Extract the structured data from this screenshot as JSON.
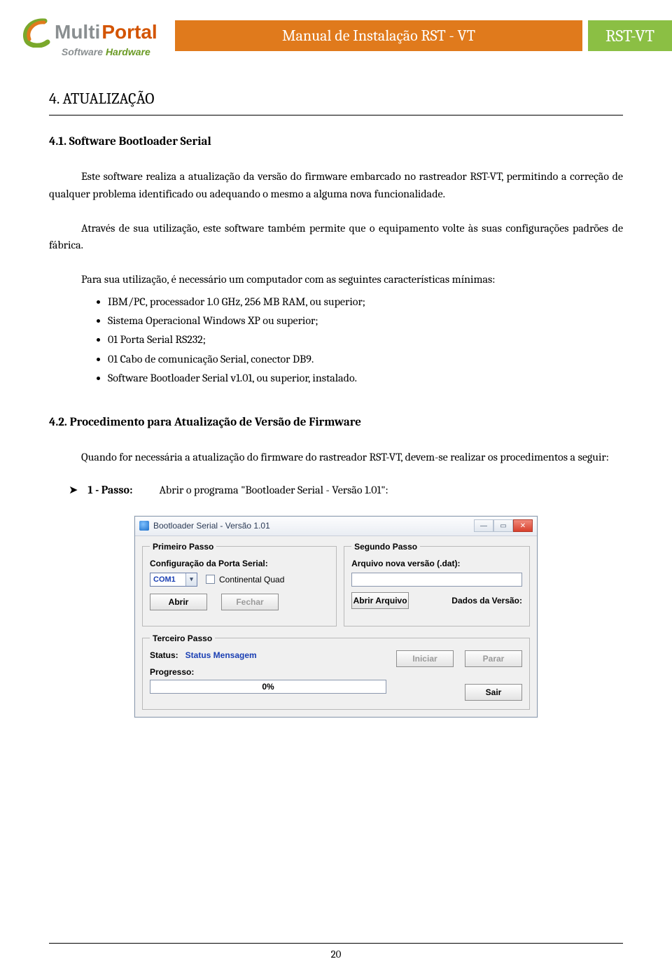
{
  "header": {
    "logo_main_1": "Multi",
    "logo_main_2": "Portal",
    "logo_sub_1": "Software",
    "logo_sub_2": "Hardware",
    "title": "Manual de Instalação RST - VT",
    "badge": "RST-VT"
  },
  "section": {
    "heading": "4. ATUALIZAÇÃO",
    "sub1": "4.1. Software Bootloader Serial",
    "p1": "Este software realiza a atualização da versão do firmware embarcado no rastreador RST-VT, permitindo a correção de qualquer problema identificado ou adequando o mesmo a alguma nova funcionalidade.",
    "p2": "Através de sua utilização, este software também permite que o equipamento volte às suas configurações padrões de fábrica.",
    "p3": "Para sua utilização, é necessário um computador com as seguintes características mínimas:",
    "reqs": [
      "IBM/PC, processador 1.0 GHz, 256 MB RAM, ou superior;",
      "Sistema Operacional Windows XP ou superior;",
      "01 Porta Serial RS232;",
      "01 Cabo de comunicação Serial, conector DB9.",
      "Software Bootloader Serial v1.01, ou superior, instalado."
    ],
    "sub2": "4.2. Procedimento para Atualização de Versão de Firmware",
    "p4": "Quando for necessária a atualização do firmware do rastreador RST-VT, devem-se realizar os procedimentos a seguir:",
    "step_label": "1 - Passo:",
    "step_desc": "Abrir o programa \"Bootloader Serial - Versão 1.01\":"
  },
  "dialog": {
    "title": "Bootloader Serial - Versão 1.01",
    "group1": {
      "legend": "Primeiro Passo",
      "label": "Configuração da Porta Serial:",
      "combo": "COM1",
      "checkbox": "Continental Quad",
      "btn_open": "Abrir",
      "btn_close": "Fechar"
    },
    "group2": {
      "legend": "Segundo Passo",
      "label": "Arquivo nova versão (.dat):",
      "btn_open_file": "Abrir Arquivo",
      "note": "Dados da Versão:"
    },
    "group3": {
      "legend": "Terceiro Passo",
      "status_label": "Status:",
      "status_value": "Status Mensagem",
      "progress_label": "Progresso:",
      "progress_value": "0%",
      "btn_start": "Iniciar",
      "btn_stop": "Parar",
      "btn_exit": "Sair"
    },
    "win": {
      "min": "—",
      "max": "▭",
      "close": "✕"
    }
  },
  "page_number": "20"
}
